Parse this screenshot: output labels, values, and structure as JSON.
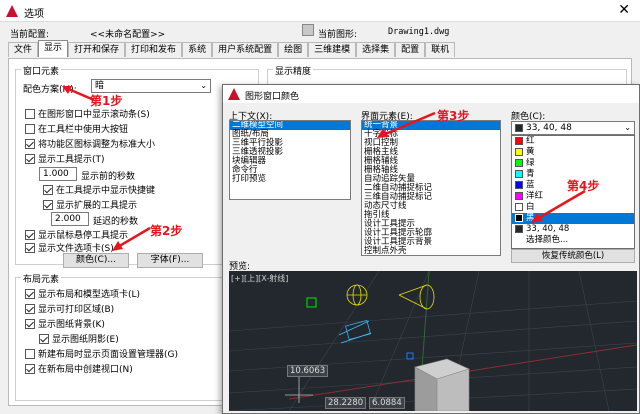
{
  "options_dialog": {
    "title": "选项",
    "current_profile_label": "当前配置:",
    "current_profile_value": "<<未命名配置>>",
    "current_drawing_label": "当前图形:",
    "current_drawing_value": "Drawing1.dwg",
    "tabs": [
      "文件",
      "显示",
      "打开和保存",
      "打印和发布",
      "系统",
      "用户系统配置",
      "绘图",
      "三维建模",
      "选择集",
      "配置",
      "联机"
    ],
    "window_elements": {
      "group_label": "窗口元素",
      "color_scheme_label": "配色方案(M):",
      "color_scheme_value": "暗",
      "items": [
        {
          "label": "在图形窗口中显示滚动条(S)",
          "checked": false
        },
        {
          "label": "在工具栏中使用大按钮",
          "checked": false
        },
        {
          "label": "将功能区图标调整为标准大小",
          "checked": true
        },
        {
          "label": "显示工具提示(T)",
          "checked": true
        }
      ],
      "delay_value": "1.000",
      "delay_label": "显示前的秒数",
      "shortcut_label": "在工具提示中显示快捷键",
      "extended_label": "显示扩展的工具提示",
      "ext_delay_value": "2.000",
      "ext_delay_label": "延迟的秒数",
      "rollover_label": "显示鼠标悬停工具提示",
      "file_tabs_label": "显示文件选项卡(S)",
      "colors_button": "颜色(C)...",
      "fonts_button": "字体(F)..."
    },
    "layout_elements": {
      "group_label": "布局元素",
      "items": [
        {
          "label": "显示布局和模型选项卡(L)",
          "checked": true
        },
        {
          "label": "显示可打印区域(B)",
          "checked": true
        },
        {
          "label": "显示图纸背景(K)",
          "checked": true
        },
        {
          "label": "显示图纸阴影(E)",
          "checked": true
        },
        {
          "label": "新建布局时显示页面设置管理器(G)",
          "checked": false
        },
        {
          "label": "在新布局中创建视口(N)",
          "checked": true
        }
      ]
    },
    "display_resolution_label": "显示精度"
  },
  "color_dialog": {
    "title": "图形窗口颜色",
    "context_label": "上下文(X):",
    "context_items": [
      "二维模型空间",
      "图纸/布局",
      "三维平行投影",
      "三维透视投影",
      "块编辑器",
      "命令行",
      "打印预览"
    ],
    "interface_label": "界面元素(E):",
    "interface_items": [
      "统一背景",
      "十字光标",
      "视口控制",
      "栅格主线",
      "栅格辅线",
      "栅格轴线",
      "自动追踪矢量",
      "二维自动捕捉标记",
      "三维自动捕捉标记",
      "动态尺寸线",
      "拖引线",
      "设计工具提示",
      "设计工具提示轮廓",
      "设计工具提示背景",
      "控制点外壳"
    ],
    "color_label": "颜色(C):",
    "color_value": "33, 40, 48",
    "color_options": [
      {
        "label": "红",
        "color": "#ff0000"
      },
      {
        "label": "黄",
        "color": "#ffff00"
      },
      {
        "label": "绿",
        "color": "#00ff00"
      },
      {
        "label": "青",
        "color": "#00ffff"
      },
      {
        "label": "蓝",
        "color": "#0000ff"
      },
      {
        "label": "洋红",
        "color": "#ff00ff"
      },
      {
        "label": "白",
        "color": "#ffffff"
      },
      {
        "label": "黑",
        "color": "#000000"
      },
      {
        "label": "33, 40, 48",
        "color": "#212830"
      },
      {
        "label": "选择颜色...",
        "color": ""
      }
    ],
    "restore_button": "恢复传统颜色(L)",
    "preview_label": "预览:",
    "viewport_label": "[+][上][X-射线]",
    "dim_values": [
      "10.6063",
      "28.2280",
      "6.0884"
    ]
  },
  "annotations": [
    "第1步",
    "第2步",
    "第3步",
    "第4步"
  ],
  "colors": {
    "annotation_red": "#e8141e",
    "selection_blue": "#0078d7",
    "preview_bg": "#23272e"
  }
}
